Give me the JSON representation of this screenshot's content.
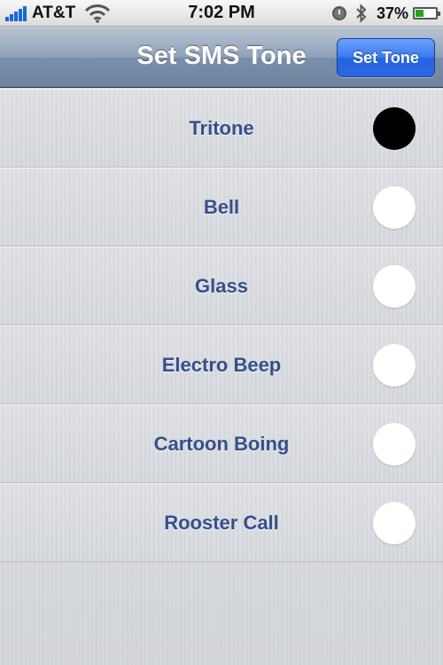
{
  "status_bar": {
    "carrier": "AT&T",
    "time": "7:02 PM",
    "battery_percent": "37",
    "battery_suffix": "%",
    "battery_level": 0.37,
    "icons": [
      "signal-bars-icon",
      "wifi-icon",
      "clock-icon",
      "bluetooth-icon",
      "battery-icon"
    ]
  },
  "nav": {
    "title": "Set SMS Tone",
    "button_label": "Set Tone"
  },
  "tones": [
    {
      "label": "Tritone",
      "selected": true
    },
    {
      "label": "Bell",
      "selected": false
    },
    {
      "label": "Glass",
      "selected": false
    },
    {
      "label": "Electro Beep",
      "selected": false
    },
    {
      "label": "Cartoon Boing",
      "selected": false
    },
    {
      "label": "Rooster Call",
      "selected": false
    }
  ],
  "colors": {
    "accent_button": "#2a68e6",
    "row_label": "#34508a",
    "selected_radio": "#000000",
    "battery_fill": "#25a21f"
  }
}
